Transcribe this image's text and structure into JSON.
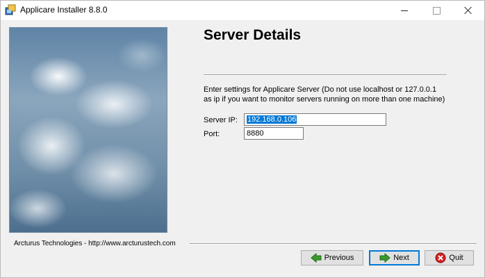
{
  "window": {
    "title": "Applicare Installer 8.8.0",
    "controls": {
      "minimize": "minimize",
      "maximize": "maximize",
      "close": "close"
    }
  },
  "page": {
    "heading": "Server Details",
    "description_line1": "Enter settings for Applicare Server (Do not use localhost or 127.0.0.1",
    "description_line2": "as ip if you want to monitor servers running on more than one machine)"
  },
  "form": {
    "server_ip_label": "Server IP:",
    "server_ip_value": "192.168.0.106",
    "port_label": "Port:",
    "port_value": "8880"
  },
  "footer": {
    "company": "Arcturus Technologies - http://www.arcturustech.com",
    "buttons": {
      "previous": "Previous",
      "next": "Next",
      "quit": "Quit"
    }
  },
  "icons": {
    "app": "installer-app-icon",
    "previous": "green-arrow-left-icon",
    "next": "green-arrow-right-icon",
    "quit": "red-x-circle-icon"
  },
  "colors": {
    "selection": "#0078d7",
    "arrow_green": "#3a9a2c",
    "quit_red": "#d42020"
  }
}
